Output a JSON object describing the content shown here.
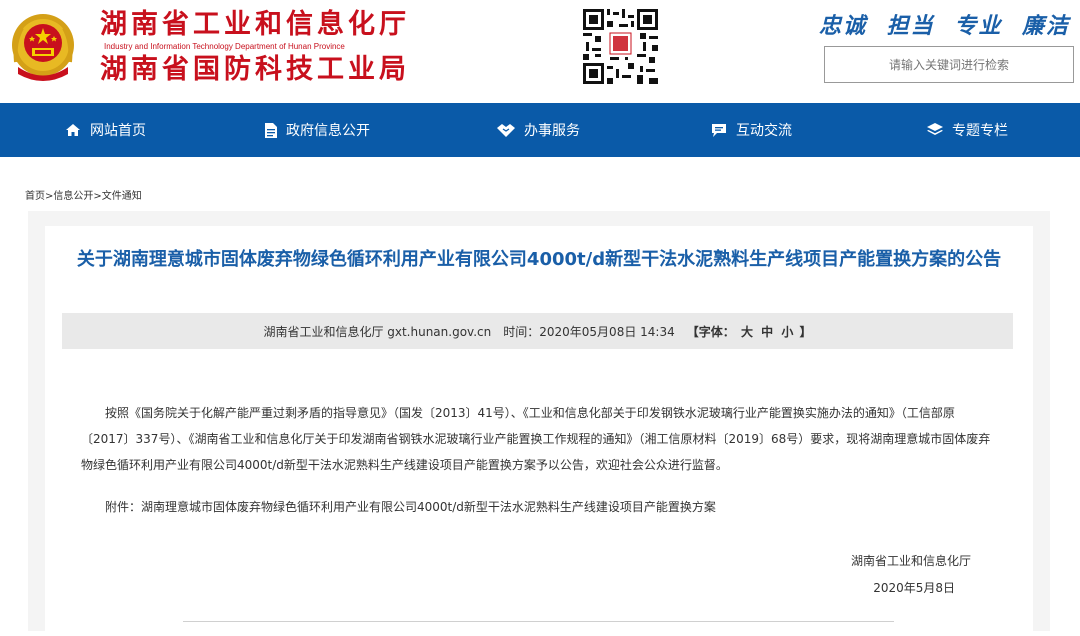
{
  "header": {
    "title_line1": "湖南省工业和信息化厅",
    "title_en": "Industry and Information Technology Department of Hunan Province",
    "title_line2": "湖南省国防科技工业局",
    "slogan": "忠诚 担当 专业 廉洁",
    "search_placeholder": "请输入关键词进行检索",
    "emblem_icon": "national-emblem-icon",
    "qr_icon": "qr-code-icon"
  },
  "nav": {
    "items": [
      {
        "label": "网站首页",
        "icon": "home-icon"
      },
      {
        "label": "政府信息公开",
        "icon": "document-icon"
      },
      {
        "label": "办事服务",
        "icon": "handshake-icon"
      },
      {
        "label": "互动交流",
        "icon": "chat-icon"
      },
      {
        "label": "专题专栏",
        "icon": "layers-icon"
      }
    ]
  },
  "breadcrumb": {
    "home": "首页",
    "sep": ">",
    "level1": "信息公开",
    "level2": "文件通知"
  },
  "article": {
    "title": "关于湖南理意城市固体废弃物绿色循环利用产业有限公司4000t/d新型干法水泥熟料生产线项目产能置换方案的公告",
    "source": "湖南省工业和信息化厅 gxt.hunan.gov.cn",
    "time_label": "时间：",
    "time": "2020年05月08日 14:34",
    "font_label_open": "【字体：",
    "font_large": "大",
    "font_medium": "中",
    "font_small": "小",
    "font_label_close": "】",
    "body": "按照《国务院关于化解产能严重过剩矛盾的指导意见》（国发〔2013〕41号）、《工业和信息化部关于印发钢铁水泥玻璃行业产能置换实施办法的通知》（工信部原〔2017〕337号）、《湖南省工业和信息化厅关于印发湖南省钢铁水泥玻璃行业产能置换工作规程的通知》（湘工信原材料〔2019〕68号）要求，现将湖南理意城市固体废弃物绿色循环利用产业有限公司4000t/d新型干法水泥熟料生产线建设项目产能置换方案予以公告，欢迎社会公众进行监督。",
    "attachment_label": "附件：",
    "attachment": "湖南理意城市固体废弃物绿色循环利用产业有限公司4000t/d新型干法水泥熟料生产线建设项目产能置换方案",
    "signer": "湖南省工业和信息化厅",
    "sign_date": "2020年5月8日"
  },
  "colors": {
    "brand_red": "#c8101d",
    "nav_blue": "#0a5aa8",
    "title_blue": "#1a5fa8"
  }
}
